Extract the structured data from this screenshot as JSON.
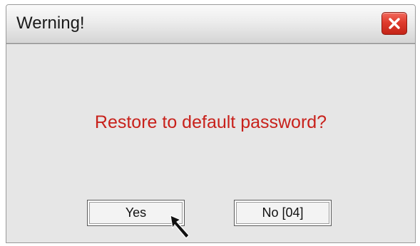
{
  "dialog": {
    "title": "Werning!",
    "close_icon": "close-x-icon",
    "message": "Restore to default password?",
    "buttons": {
      "yes_label": "Yes",
      "no_label": "No [04]"
    }
  },
  "colors": {
    "message": "#c8211b",
    "close_button": "#df3b2d",
    "dialog_background": "#e6e6e6"
  },
  "pointer_icon": "mouse-pointer-icon"
}
